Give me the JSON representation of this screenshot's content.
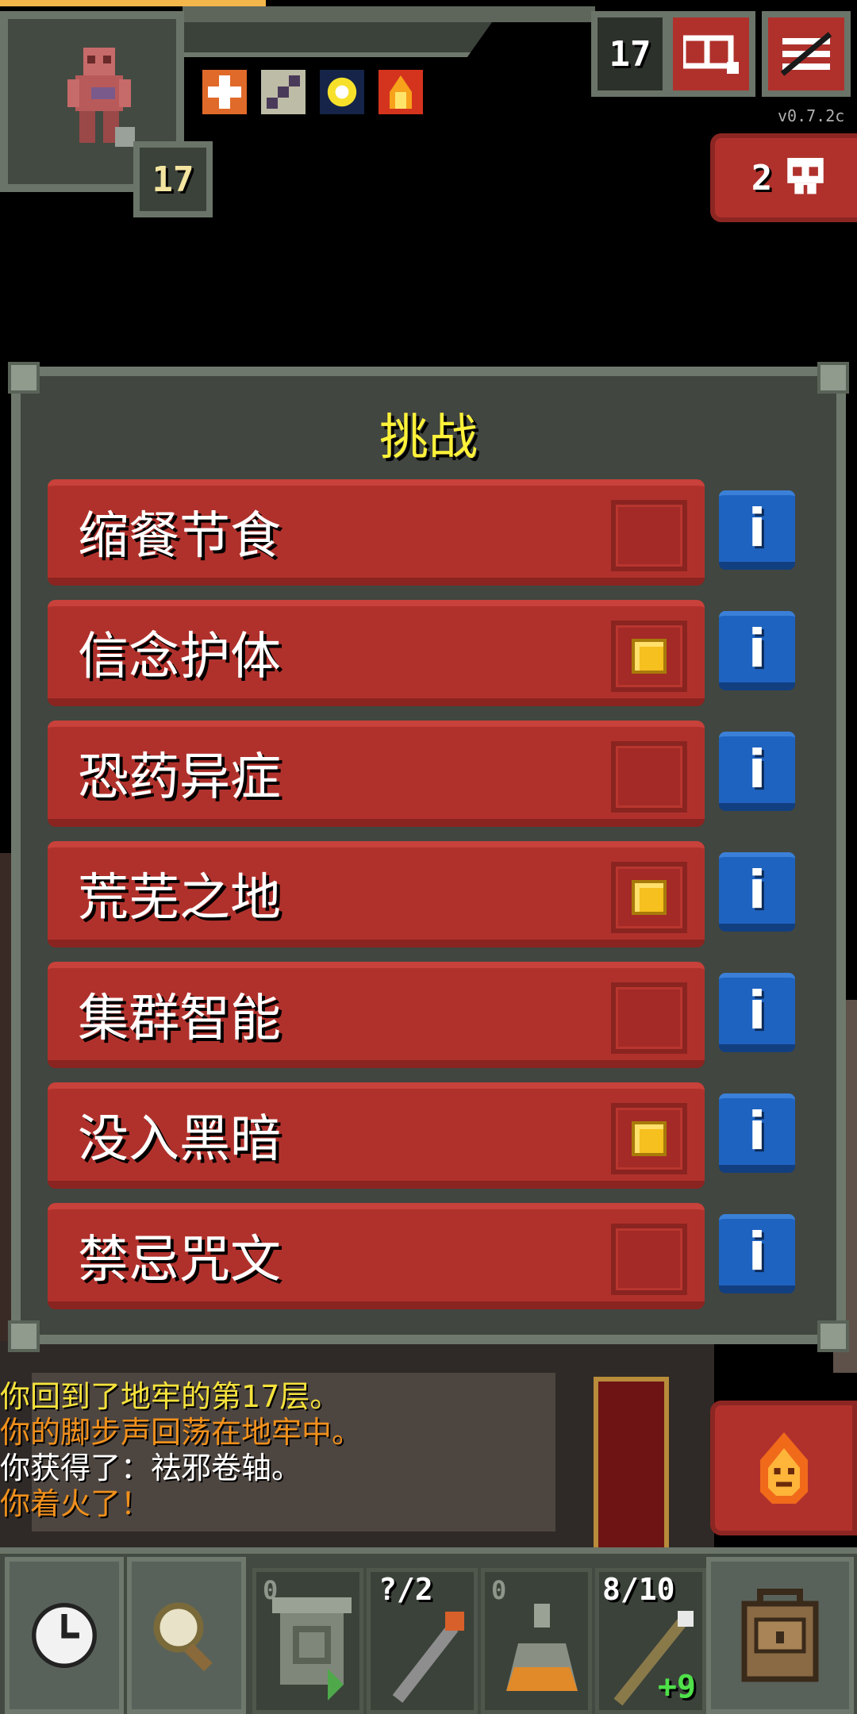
{
  "hud": {
    "hero_level": "17",
    "depth": "17",
    "version": "v0.7.2c",
    "danger_count": "2",
    "buff_icons": [
      "bless-buff-icon",
      "haste-buff-icon",
      "light-buff-icon",
      "burning-buff-icon"
    ],
    "journal_icon": "journal-icon",
    "menu_icon": "menu-icon"
  },
  "dialog": {
    "title": "挑战",
    "challenges": [
      {
        "label": "缩餐节食",
        "checked": false
      },
      {
        "label": "信念护体",
        "checked": true
      },
      {
        "label": "恐药异症",
        "checked": false
      },
      {
        "label": "荒芜之地",
        "checked": true
      },
      {
        "label": "集群智能",
        "checked": false
      },
      {
        "label": "没入黑暗",
        "checked": true
      },
      {
        "label": "禁忌咒文",
        "checked": false
      }
    ],
    "info_glyph": "i"
  },
  "log": [
    {
      "text": "你回到了地牢的第17层。",
      "color": "yellow"
    },
    {
      "text": "你的脚步声回荡在地牢中。",
      "color": "orange"
    },
    {
      "text": "你获得了：祛邪卷轴。",
      "color": "white"
    },
    {
      "text": "你着火了！",
      "color": "orange"
    }
  ],
  "toolbar": {
    "slots": [
      {
        "icon": "scroll-icon",
        "zero": "0",
        "count": ""
      },
      {
        "icon": "wand-icon",
        "zero": "",
        "count": "?/2"
      },
      {
        "icon": "potion-icon",
        "zero": "0",
        "count": ""
      },
      {
        "icon": "staff-icon",
        "zero": "",
        "count": "8/10",
        "bonus": "+9"
      }
    ]
  },
  "colors": {
    "panel": "#414640",
    "panel_border": "#6f786c",
    "row_red": "#b0312c",
    "info_blue": "#1f63c0",
    "check_yellow": "#f6c01e",
    "title_yellow": "#fff23a",
    "log_yellow": "#f5e23c",
    "log_orange": "#f0901c"
  }
}
